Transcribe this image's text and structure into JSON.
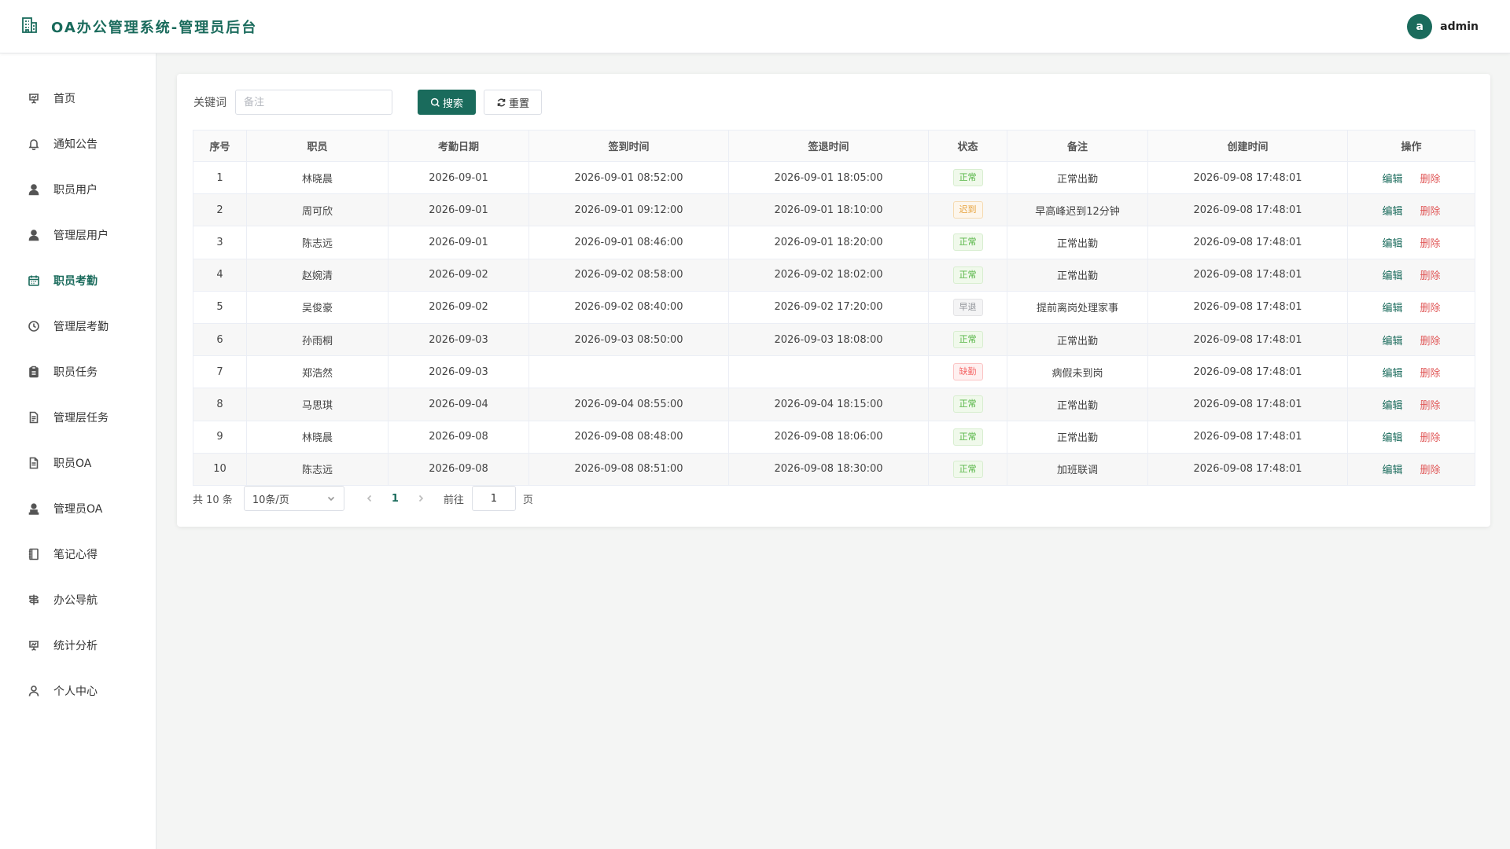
{
  "header": {
    "title": "OA办公管理系统-管理员后台",
    "user": {
      "avatar_letter": "a",
      "name": "admin"
    },
    "accent_color": "#1a6b5c"
  },
  "sidebar": {
    "items": [
      {
        "label": "首页",
        "icon": "presentation-icon"
      },
      {
        "label": "通知公告",
        "icon": "bell-icon"
      },
      {
        "label": "职员用户",
        "icon": "user-icon"
      },
      {
        "label": "管理层用户",
        "icon": "user-icon"
      },
      {
        "label": "职员考勤",
        "icon": "calendar-icon",
        "active": true
      },
      {
        "label": "管理层考勤",
        "icon": "clock-icon"
      },
      {
        "label": "职员任务",
        "icon": "clipboard-icon"
      },
      {
        "label": "管理层任务",
        "icon": "document-icon"
      },
      {
        "label": "职员OA",
        "icon": "file-icon"
      },
      {
        "label": "管理员OA",
        "icon": "user-stamp-icon"
      },
      {
        "label": "笔记心得",
        "icon": "notebook-icon"
      },
      {
        "label": "办公导航",
        "icon": "signpost-icon"
      },
      {
        "label": "统计分析",
        "icon": "chart-board-icon"
      },
      {
        "label": "个人中心",
        "icon": "person-icon"
      }
    ]
  },
  "search": {
    "label": "关键词",
    "placeholder": "备注",
    "value": "",
    "search_button": "搜索",
    "reset_button": "重置"
  },
  "table": {
    "columns": [
      "序号",
      "职员",
      "考勤日期",
      "签到时间",
      "签退时间",
      "状态",
      "备注",
      "创建时间",
      "操作"
    ],
    "edit_label": "编辑",
    "delete_label": "删除",
    "rows": [
      {
        "no": "1",
        "name": "林晓晨",
        "date": "2026-09-01",
        "checkin": "2026-09-01 08:52:00",
        "checkout": "2026-09-01 18:05:00",
        "status": "正常",
        "status_type": "normal",
        "remark": "正常出勤",
        "created": "2026-09-08 17:48:01"
      },
      {
        "no": "2",
        "name": "周可欣",
        "date": "2026-09-01",
        "checkin": "2026-09-01 09:12:00",
        "checkout": "2026-09-01 18:10:00",
        "status": "迟到",
        "status_type": "late",
        "remark": "早高峰迟到12分钟",
        "created": "2026-09-08 17:48:01"
      },
      {
        "no": "3",
        "name": "陈志远",
        "date": "2026-09-01",
        "checkin": "2026-09-01 08:46:00",
        "checkout": "2026-09-01 18:20:00",
        "status": "正常",
        "status_type": "normal",
        "remark": "正常出勤",
        "created": "2026-09-08 17:48:01"
      },
      {
        "no": "4",
        "name": "赵婉清",
        "date": "2026-09-02",
        "checkin": "2026-09-02 08:58:00",
        "checkout": "2026-09-02 18:02:00",
        "status": "正常",
        "status_type": "normal",
        "remark": "正常出勤",
        "created": "2026-09-08 17:48:01"
      },
      {
        "no": "5",
        "name": "吴俊豪",
        "date": "2026-09-02",
        "checkin": "2026-09-02 08:40:00",
        "checkout": "2026-09-02 17:20:00",
        "status": "早退",
        "status_type": "early",
        "remark": "提前离岗处理家事",
        "created": "2026-09-08 17:48:01"
      },
      {
        "no": "6",
        "name": "孙雨桐",
        "date": "2026-09-03",
        "checkin": "2026-09-03 08:50:00",
        "checkout": "2026-09-03 18:08:00",
        "status": "正常",
        "status_type": "normal",
        "remark": "正常出勤",
        "created": "2026-09-08 17:48:01"
      },
      {
        "no": "7",
        "name": "郑浩然",
        "date": "2026-09-03",
        "checkin": "",
        "checkout": "",
        "status": "缺勤",
        "status_type": "absent",
        "remark": "病假未到岗",
        "created": "2026-09-08 17:48:01"
      },
      {
        "no": "8",
        "name": "马思琪",
        "date": "2026-09-04",
        "checkin": "2026-09-04 08:55:00",
        "checkout": "2026-09-04 18:15:00",
        "status": "正常",
        "status_type": "normal",
        "remark": "正常出勤",
        "created": "2026-09-08 17:48:01"
      },
      {
        "no": "9",
        "name": "林晓晨",
        "date": "2026-09-08",
        "checkin": "2026-09-08 08:48:00",
        "checkout": "2026-09-08 18:06:00",
        "status": "正常",
        "status_type": "normal",
        "remark": "正常出勤",
        "created": "2026-09-08 17:48:01"
      },
      {
        "no": "10",
        "name": "陈志远",
        "date": "2026-09-08",
        "checkin": "2026-09-08 08:51:00",
        "checkout": "2026-09-08 18:30:00",
        "status": "正常",
        "status_type": "normal",
        "remark": "加班联调",
        "created": "2026-09-08 17:48:01"
      }
    ]
  },
  "pagination": {
    "total": "共 10 条",
    "page_size": "10条/页",
    "current_page": "1",
    "goto_label": "前往",
    "goto_value": "1",
    "goto_suffix": "页"
  }
}
